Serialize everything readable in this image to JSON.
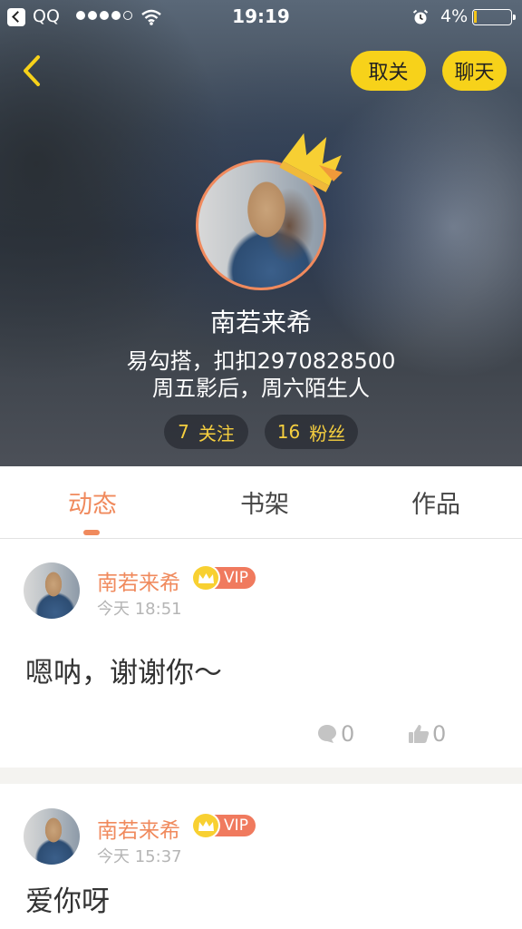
{
  "status_bar": {
    "carrier": "QQ",
    "time": "19:19",
    "battery": "4%",
    "icons": [
      "back-app-icon",
      "signal-dots-icon",
      "wifi-icon",
      "alarm-icon",
      "battery-icon"
    ]
  },
  "nav": {
    "unfollow_label": "取关",
    "chat_label": "聊天",
    "back_icon": "chevron-left-icon"
  },
  "profile": {
    "name": "南若来希",
    "bio_line1": "易勾搭，扣扣2970828500",
    "bio_line2": "周五影后，周六陌生人",
    "following_count": "7",
    "following_label": "关注",
    "followers_count": "16",
    "followers_label": "粉丝",
    "badge_icon": "crown-icon"
  },
  "tabs": [
    {
      "label": "动态",
      "active": true
    },
    {
      "label": "书架",
      "active": false
    },
    {
      "label": "作品",
      "active": false
    }
  ],
  "posts": [
    {
      "author": "南若来希",
      "vip_label": "VIP",
      "time": "今天 18:51",
      "text": "嗯呐，谢谢你～",
      "comments": "0",
      "likes": "0"
    },
    {
      "author": "南若来希",
      "vip_label": "VIP",
      "time": "今天 15:37",
      "text": "爱你呀"
    }
  ],
  "colors": {
    "accent_orange": "#f08a5d",
    "button_yellow": "#f7d21a",
    "stat_text_yellow": "#f6cf3f",
    "vip_red": "#f07a5e"
  }
}
